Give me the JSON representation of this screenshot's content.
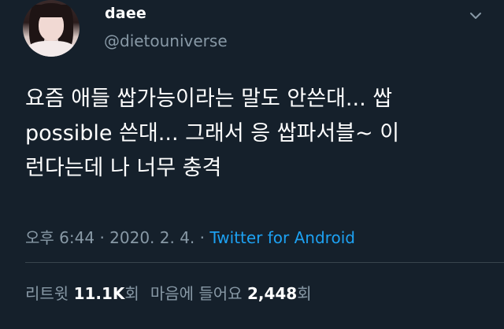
{
  "user": {
    "display_name": "daee",
    "handle": "@dietouniverse"
  },
  "tweet": {
    "text": "요즘 애들 쌉가능이라는 말도 안쓴대... 쌉\npossible 쓴대... 그래서 응 쌉파서블~ 이\n런다는데 나 너무 충격"
  },
  "meta": {
    "time": "오후 6:44",
    "separator1": "·",
    "date": "2020. 2. 4.",
    "separator2": "·",
    "source": "Twitter for Android"
  },
  "stats": {
    "retweets_label": "리트윗",
    "retweets_count": "11.1K",
    "retweets_unit": "회",
    "likes_label": "마음에 들어요",
    "likes_count": "2,448",
    "likes_unit": "회"
  },
  "icons": {
    "avatar": "profile-photo",
    "menu": "chevron-down-icon"
  },
  "colors": {
    "background": "#15202b",
    "secondary_text": "#8899a6",
    "link": "#1da1f2"
  }
}
